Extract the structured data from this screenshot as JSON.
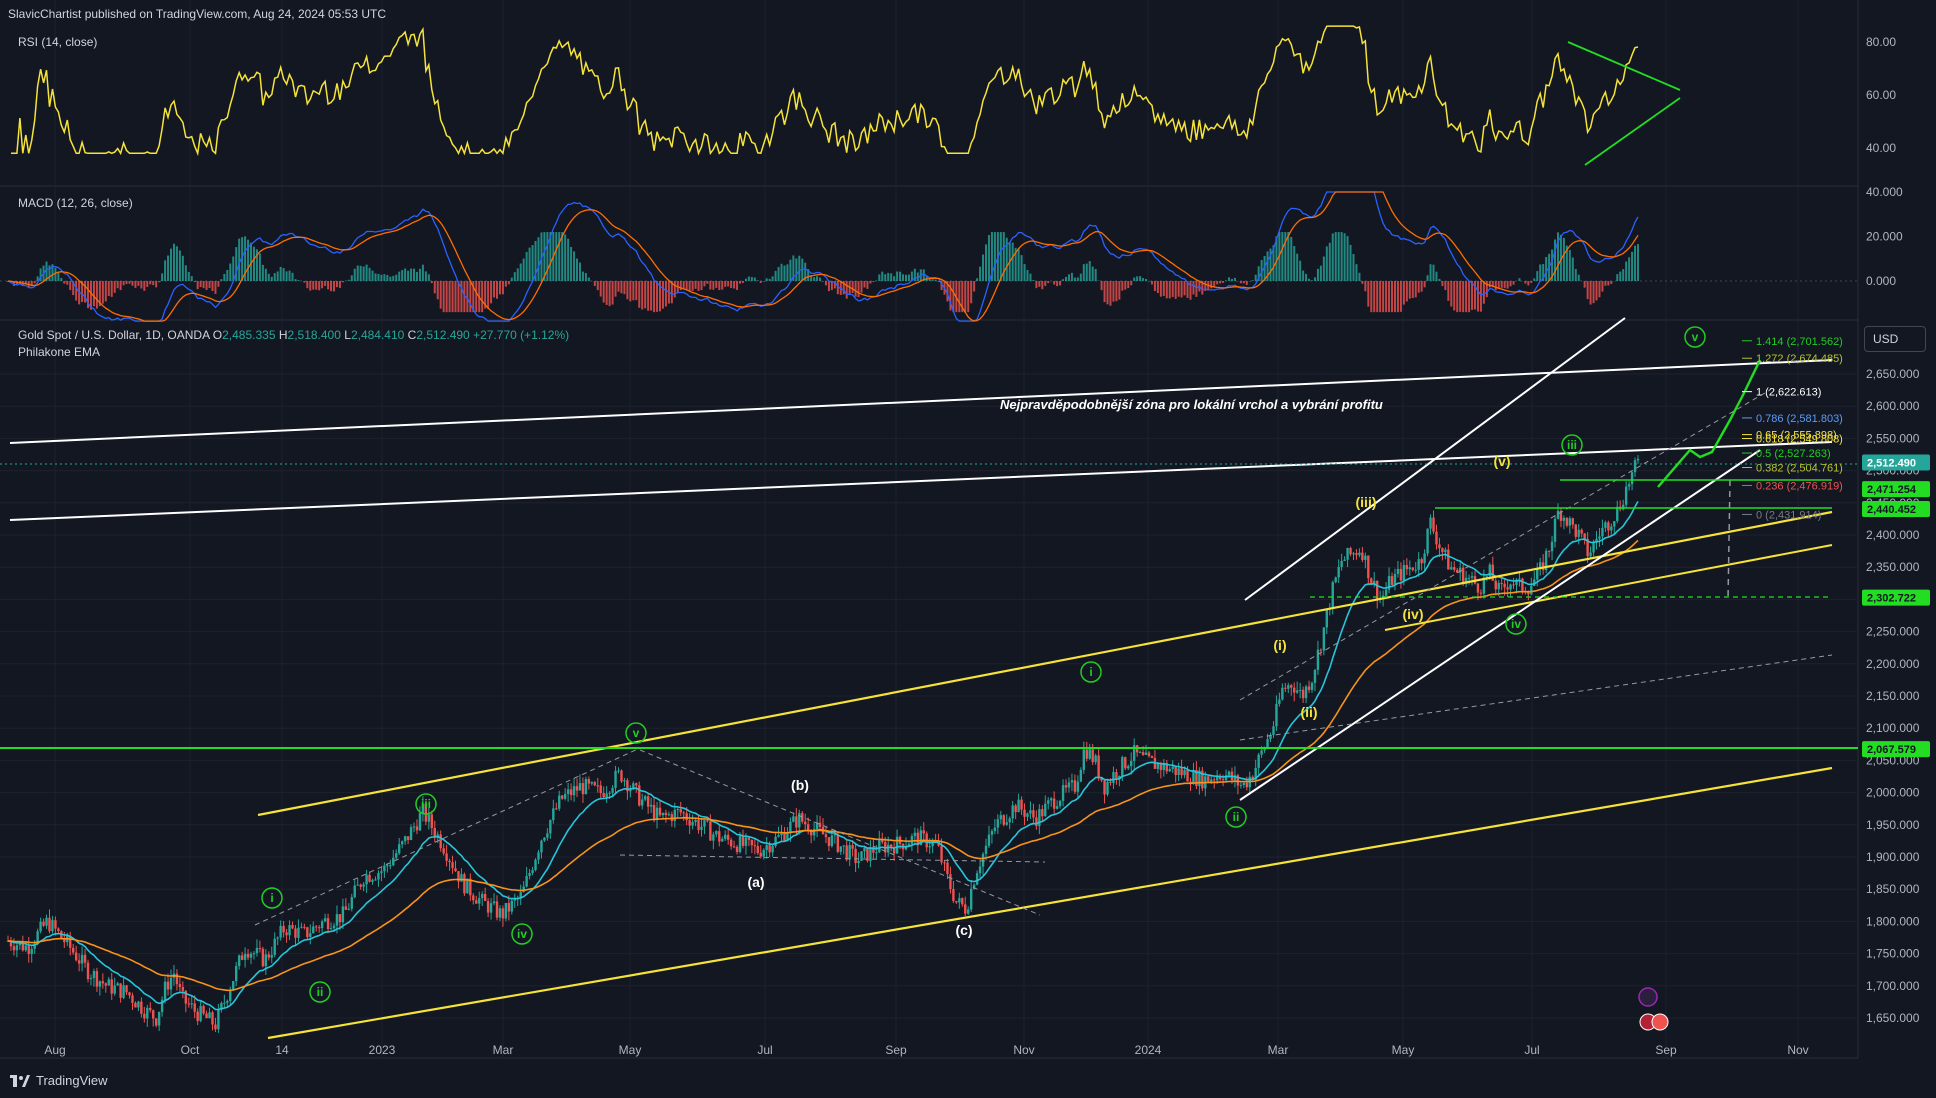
{
  "header": {
    "publish_info": "SlavicChartist published on TradingView.com, Aug 24, 2024 05:53 UTC"
  },
  "footer": {
    "brand": "TradingView"
  },
  "panes": {
    "rsi": {
      "label": "RSI (14, close)",
      "ticks": [
        "80.00",
        "60.00",
        "40.00"
      ]
    },
    "macd": {
      "label": "MACD (12, 26, close)",
      "ticks": [
        "40.000",
        "20.000",
        "0.000"
      ]
    },
    "price": {
      "symbol": "Gold Spot / U.S. Dollar, 1D, OANDA",
      "open_label": "O",
      "open": "2,485.335",
      "high_label": "H",
      "high": "2,518.400",
      "low_label": "L",
      "low": "2,484.410",
      "close_label": "C",
      "close": "2,512.490",
      "change": "+27.770 (+1.12%)",
      "indicator": "Philakone EMA",
      "currency_button": "USD"
    }
  },
  "colors": {
    "background": "#131722",
    "rsi_line": "#f5e33a",
    "macd_line": "#2962ff",
    "signal_line": "#ff6d00",
    "ema_fast": "#26c6da",
    "ema_slow": "#f7931a",
    "channel_yellow": "#f5e33a",
    "channel_white": "#ffffff",
    "hline_green": "#22dd22",
    "wave_green": "#22cc22",
    "candle_up": "#26a69a",
    "candle_down": "#ef5350"
  },
  "chart_data": {
    "type": "candlestick",
    "title": "Gold Spot / U.S. Dollar, 1D, OANDA",
    "annotation": "Nejpravděpodobnější zóna pro lokální vrchol a vybrání profitu",
    "x_ticks": [
      "Aug",
      "Oct",
      "14",
      "2023",
      "Mar",
      "May",
      "Jul",
      "Sep",
      "Nov",
      "2024",
      "Mar",
      "May",
      "Jul",
      "Sep",
      "Nov"
    ],
    "y_ticks": [
      "2,650.000",
      "2,600.000",
      "2,550.000",
      "2,500.000",
      "2,450.000",
      "2,400.000",
      "2,350.000",
      "2,300.000",
      "2,250.000",
      "2,200.000",
      "2,150.000",
      "2,100.000",
      "2,050.000",
      "2,000.000",
      "1,950.000",
      "1,900.000",
      "1,850.000",
      "1,800.000",
      "1,750.000",
      "1,700.000",
      "1,650.000"
    ],
    "ylim": [
      1625,
      2685
    ],
    "price_labels": [
      {
        "text": "2,512.490",
        "value": 2512.49,
        "color": "#26a69a"
      },
      {
        "text": "2,471.254",
        "value": 2471.254,
        "color": "#22dd22"
      },
      {
        "text": "2,440.452",
        "value": 2440.452,
        "color": "#22dd22"
      },
      {
        "text": "2,302.722",
        "value": 2302.722,
        "color": "#22dd22"
      },
      {
        "text": "2,067.579",
        "value": 2067.579,
        "color": "#22dd22"
      }
    ],
    "fib_levels": [
      {
        "label": "1.414 (2,701.562)",
        "value": 2701.562,
        "color": "#22cc22"
      },
      {
        "label": "1.272 (2,674.485)",
        "value": 2674.485,
        "color": "#b5c32b"
      },
      {
        "label": "1 (2,622.613)",
        "value": 2622.613,
        "color": "#ffffff"
      },
      {
        "label": "0.786 (2,581.803)",
        "value": 2581.803,
        "color": "#5b9cf6"
      },
      {
        "label": "0.65 (2,555.898)",
        "value": 2555.898,
        "color": "#f5e33a"
      },
      {
        "label": "0.618 (2,549.808)",
        "value": 2549.808,
        "color": "#f5e33a"
      },
      {
        "label": "0.5 (2,527.263)",
        "value": 2527.263,
        "color": "#22cc22"
      },
      {
        "label": "0.382 (2,504.761)",
        "value": 2504.761,
        "color": "#b5c32b"
      },
      {
        "label": "0.236 (2,476.919)",
        "value": 2476.919,
        "color": "#ef5350"
      },
      {
        "label": "0 (2,431.914)",
        "value": 2431.914,
        "color": "#787b86"
      }
    ],
    "wave_labels": [
      {
        "text": "i",
        "style": "circle-green"
      },
      {
        "text": "ii",
        "style": "circle-green"
      },
      {
        "text": "iii",
        "style": "circle-green"
      },
      {
        "text": "iv",
        "style": "circle-green"
      },
      {
        "text": "v",
        "style": "circle-green"
      },
      {
        "text": "(a)",
        "style": "white"
      },
      {
        "text": "(b)",
        "style": "white"
      },
      {
        "text": "(c)",
        "style": "white"
      },
      {
        "text": "i",
        "style": "circle-green"
      },
      {
        "text": "ii",
        "style": "circle-green"
      },
      {
        "text": "(i)",
        "style": "yellow"
      },
      {
        "text": "(ii)",
        "style": "yellow"
      },
      {
        "text": "(iii)",
        "style": "yellow"
      },
      {
        "text": "(iv)",
        "style": "yellow"
      },
      {
        "text": "(v)",
        "style": "yellow"
      },
      {
        "text": "iii",
        "style": "circle-green"
      },
      {
        "text": "iv",
        "style": "circle-green"
      },
      {
        "text": "v",
        "style": "circle-green"
      }
    ],
    "price_path": [
      [
        0,
        1770
      ],
      [
        20,
        1760
      ],
      [
        40,
        1800
      ],
      [
        60,
        1765
      ],
      [
        80,
        1725
      ],
      [
        100,
        1700
      ],
      [
        120,
        1690
      ],
      [
        140,
        1660
      ],
      [
        150,
        1650
      ],
      [
        160,
        1700
      ],
      [
        168,
        1720
      ],
      [
        176,
        1680
      ],
      [
        190,
        1660
      ],
      [
        210,
        1640
      ],
      [
        220,
        1680
      ],
      [
        240,
        1760
      ],
      [
        260,
        1740
      ],
      [
        280,
        1790
      ],
      [
        300,
        1780
      ],
      [
        320,
        1800
      ],
      [
        340,
        1810
      ],
      [
        360,
        1870
      ],
      [
        380,
        1880
      ],
      [
        400,
        1920
      ],
      [
        420,
        1970
      ],
      [
        440,
        1920
      ],
      [
        460,
        1860
      ],
      [
        480,
        1830
      ],
      [
        500,
        1810
      ],
      [
        520,
        1840
      ],
      [
        540,
        1930
      ],
      [
        560,
        1990
      ],
      [
        580,
        2010
      ],
      [
        600,
        2000
      ],
      [
        620,
        2030
      ],
      [
        640,
        1990
      ],
      [
        660,
        1960
      ],
      [
        680,
        1970
      ],
      [
        700,
        1950
      ],
      [
        720,
        1930
      ],
      [
        740,
        1920
      ],
      [
        760,
        1910
      ],
      [
        780,
        1930
      ],
      [
        800,
        1960
      ],
      [
        820,
        1940
      ],
      [
        840,
        1920
      ],
      [
        860,
        1895
      ],
      [
        880,
        1915
      ],
      [
        900,
        1920
      ],
      [
        920,
        1930
      ],
      [
        940,
        1920
      ],
      [
        950,
        1870
      ],
      [
        960,
        1830
      ],
      [
        970,
        1820
      ],
      [
        980,
        1880
      ],
      [
        1000,
        1950
      ],
      [
        1020,
        1980
      ],
      [
        1040,
        1960
      ],
      [
        1060,
        1990
      ],
      [
        1080,
        2010
      ],
      [
        1090,
        2070
      ],
      [
        1100,
        2050
      ],
      [
        1110,
        2010
      ],
      [
        1120,
        2030
      ],
      [
        1140,
        2060
      ],
      [
        1150,
        2050
      ],
      [
        1170,
        2040
      ],
      [
        1190,
        2030
      ],
      [
        1210,
        2020
      ],
      [
        1230,
        2030
      ],
      [
        1250,
        2010
      ],
      [
        1260,
        2030
      ],
      [
        1280,
        2100
      ],
      [
        1290,
        2160
      ],
      [
        1300,
        2170
      ],
      [
        1310,
        2150
      ],
      [
        1320,
        2180
      ],
      [
        1330,
        2240
      ],
      [
        1340,
        2310
      ],
      [
        1350,
        2360
      ],
      [
        1360,
        2370
      ],
      [
        1370,
        2380
      ],
      [
        1380,
        2330
      ],
      [
        1390,
        2300
      ],
      [
        1400,
        2330
      ],
      [
        1410,
        2340
      ],
      [
        1420,
        2350
      ],
      [
        1430,
        2360
      ],
      [
        1440,
        2420
      ],
      [
        1450,
        2380
      ],
      [
        1460,
        2350
      ],
      [
        1470,
        2340
      ],
      [
        1480,
        2330
      ],
      [
        1490,
        2320
      ],
      [
        1500,
        2340
      ],
      [
        1510,
        2310
      ],
      [
        1520,
        2330
      ],
      [
        1530,
        2320
      ],
      [
        1540,
        2320
      ],
      [
        1550,
        2340
      ],
      [
        1560,
        2380
      ],
      [
        1570,
        2440
      ],
      [
        1580,
        2420
      ],
      [
        1590,
        2400
      ],
      [
        1600,
        2370
      ],
      [
        1610,
        2400
      ],
      [
        1620,
        2420
      ],
      [
        1630,
        2440
      ],
      [
        1640,
        2480
      ],
      [
        1650,
        2512
      ]
    ]
  }
}
